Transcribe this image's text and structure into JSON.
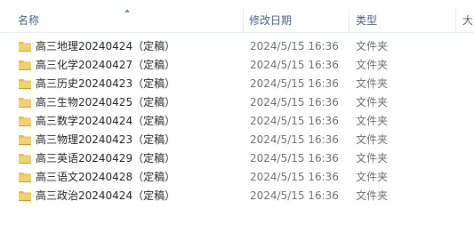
{
  "columns": {
    "name": "名称",
    "modified": "修改日期",
    "type": "类型",
    "size": "大小"
  },
  "files": [
    {
      "name": "高三地理20240424（定稿）",
      "modified": "2024/5/15 16:36",
      "type": "文件夹",
      "icon": "folder-icon"
    },
    {
      "name": "高三化学20240427（定稿）",
      "modified": "2024/5/15 16:36",
      "type": "文件夹",
      "icon": "folder-icon"
    },
    {
      "name": "高三历史20240423（定稿）",
      "modified": "2024/5/15 16:36",
      "type": "文件夹",
      "icon": "folder-icon"
    },
    {
      "name": "高三生物20240425（定稿）",
      "modified": "2024/5/15 16:36",
      "type": "文件夹",
      "icon": "folder-icon"
    },
    {
      "name": "高三数学20240424（定稿）",
      "modified": "2024/5/15 16:36",
      "type": "文件夹",
      "icon": "folder-icon"
    },
    {
      "name": "高三物理20240423（定稿）",
      "modified": "2024/5/15 16:36",
      "type": "文件夹",
      "icon": "folder-icon"
    },
    {
      "name": "高三英语20240429（定稿）",
      "modified": "2024/5/15 16:36",
      "type": "文件夹",
      "icon": "folder-icon"
    },
    {
      "name": "高三语文20240428（定稿）",
      "modified": "2024/5/15 16:36",
      "type": "文件夹",
      "icon": "folder-icon"
    },
    {
      "name": "高三政治20240424（定稿）",
      "modified": "2024/5/15 16:36",
      "type": "文件夹",
      "icon": "folder-icon"
    }
  ],
  "colors": {
    "header_text": "#4c607a",
    "secondary_text": "#6d6d6d",
    "folder": "#e8bd4a"
  }
}
